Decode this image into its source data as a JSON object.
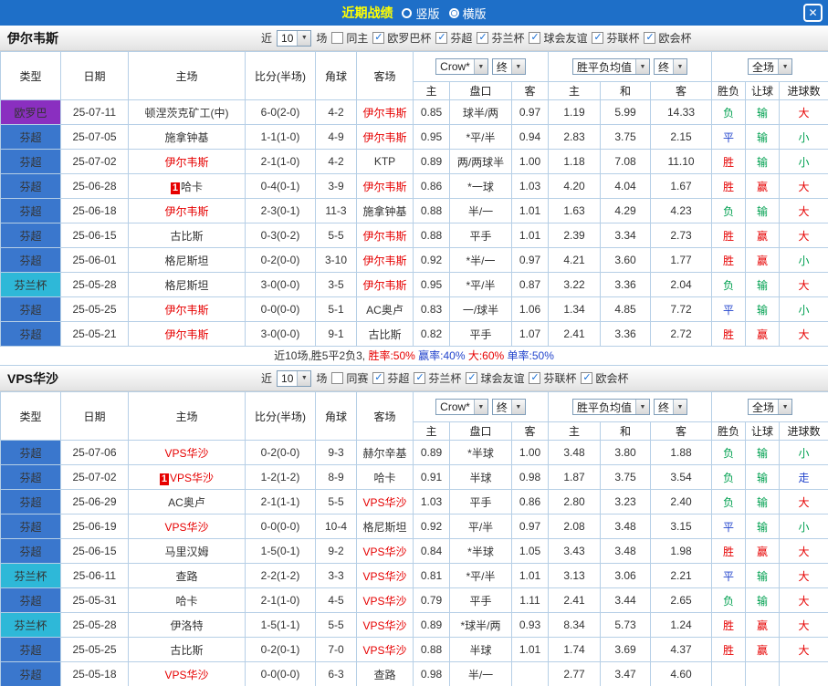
{
  "icons": {
    "dropdown": "▼",
    "check": "✓",
    "close": "✕"
  },
  "colors": {
    "titlebar_bg": "#1e6fc8",
    "title_text": "#ffff00",
    "focus_team": "#e60000",
    "opponent_team": "#333333",
    "score": "#ff0000",
    "grid": "#b6cfe6"
  },
  "titlebar": {
    "title": "近期战绩",
    "radios": [
      {
        "label": "竖版",
        "selected": false
      },
      {
        "label": "横版",
        "selected": true
      }
    ]
  },
  "header_labels": {
    "type": "类型",
    "date": "日期",
    "home": "主场",
    "score": "比分(半场)",
    "corner": "角球",
    "away": "客场",
    "odds_select": "Crow*",
    "final_select": "终",
    "avg_select": "胜平负均值",
    "scope_select": "全场",
    "sub": [
      "主",
      "盘口",
      "客",
      "主",
      "和",
      "客",
      "胜负",
      "让球",
      "进球数"
    ]
  },
  "type_colors": {
    "欧罗巴": "#8a2fc0",
    "芬超": "#3a77cd",
    "芬兰杯": "#2eb8d8"
  },
  "result_colors": {
    "胜": "#e60000",
    "赢": "#e60000",
    "大": "#e60000",
    "负": "#00a050",
    "输": "#00a050",
    "小": "#00a050",
    "平": "#2244cc",
    "走": "#2244cc"
  },
  "sections": [
    {
      "team": "伊尔韦斯",
      "filter": {
        "prefix": "近",
        "count": "10",
        "suffix": "场",
        "checkboxes": [
          {
            "label": "同主",
            "checked": false
          },
          {
            "label": "欧罗巴杯",
            "checked": true
          },
          {
            "label": "芬超",
            "checked": true
          },
          {
            "label": "芬兰杯",
            "checked": true
          },
          {
            "label": "球会友谊",
            "checked": true
          },
          {
            "label": "芬联杯",
            "checked": true
          },
          {
            "label": "欧会杯",
            "checked": true
          }
        ]
      },
      "rows": [
        {
          "type": "欧罗巴",
          "date": "25-07-11",
          "home": "顿涅茨克矿工(中)",
          "home_focus": false,
          "home_badge": "",
          "score": "6-0(2-0)",
          "corner": "4-2",
          "away": "伊尔韦斯",
          "away_focus": true,
          "odds": [
            "0.85",
            "球半/两",
            "0.97"
          ],
          "avg": [
            "1.19",
            "5.99",
            "14.33"
          ],
          "result": "负",
          "let": "输",
          "goals": "大"
        },
        {
          "type": "芬超",
          "date": "25-07-05",
          "home": "施拿钟基",
          "home_focus": false,
          "home_badge": "",
          "score": "1-1(1-0)",
          "corner": "4-9",
          "away": "伊尔韦斯",
          "away_focus": true,
          "odds": [
            "0.95",
            "*平/半",
            "0.94"
          ],
          "avg": [
            "2.83",
            "3.75",
            "2.15"
          ],
          "result": "平",
          "let": "输",
          "goals": "小"
        },
        {
          "type": "芬超",
          "date": "25-07-02",
          "home": "伊尔韦斯",
          "home_focus": true,
          "home_badge": "",
          "score": "2-1(1-0)",
          "corner": "4-2",
          "away": "KTP",
          "away_focus": false,
          "odds": [
            "0.89",
            "两/两球半",
            "1.00"
          ],
          "avg": [
            "1.18",
            "7.08",
            "11.10"
          ],
          "result": "胜",
          "let": "输",
          "goals": "小"
        },
        {
          "type": "芬超",
          "date": "25-06-28",
          "home": "哈卡",
          "home_focus": false,
          "home_badge": "1",
          "score": "0-4(0-1)",
          "corner": "3-9",
          "away": "伊尔韦斯",
          "away_focus": true,
          "odds": [
            "0.86",
            "*一球",
            "1.03"
          ],
          "avg": [
            "4.20",
            "4.04",
            "1.67"
          ],
          "result": "胜",
          "let": "赢",
          "goals": "大"
        },
        {
          "type": "芬超",
          "date": "25-06-18",
          "home": "伊尔韦斯",
          "home_focus": true,
          "home_badge": "",
          "score": "2-3(0-1)",
          "corner": "11-3",
          "away": "施拿钟基",
          "away_focus": false,
          "odds": [
            "0.88",
            "半/一",
            "1.01"
          ],
          "avg": [
            "1.63",
            "4.29",
            "4.23"
          ],
          "result": "负",
          "let": "输",
          "goals": "大"
        },
        {
          "type": "芬超",
          "date": "25-06-15",
          "home": "古比斯",
          "home_focus": false,
          "home_badge": "",
          "score": "0-3(0-2)",
          "corner": "5-5",
          "away": "伊尔韦斯",
          "away_focus": true,
          "odds": [
            "0.88",
            "平手",
            "1.01"
          ],
          "avg": [
            "2.39",
            "3.34",
            "2.73"
          ],
          "result": "胜",
          "let": "赢",
          "goals": "大"
        },
        {
          "type": "芬超",
          "date": "25-06-01",
          "home": "格尼斯坦",
          "home_focus": false,
          "home_badge": "",
          "score": "0-2(0-0)",
          "corner": "3-10",
          "away": "伊尔韦斯",
          "away_focus": true,
          "odds": [
            "0.92",
            "*半/一",
            "0.97"
          ],
          "avg": [
            "4.21",
            "3.60",
            "1.77"
          ],
          "result": "胜",
          "let": "赢",
          "goals": "小"
        },
        {
          "type": "芬兰杯",
          "date": "25-05-28",
          "home": "格尼斯坦",
          "home_focus": false,
          "home_badge": "",
          "score": "3-0(0-0)",
          "corner": "3-5",
          "away": "伊尔韦斯",
          "away_focus": true,
          "odds": [
            "0.95",
            "*平/半",
            "0.87"
          ],
          "avg": [
            "3.22",
            "3.36",
            "2.04"
          ],
          "result": "负",
          "let": "输",
          "goals": "大"
        },
        {
          "type": "芬超",
          "date": "25-05-25",
          "home": "伊尔韦斯",
          "home_focus": true,
          "home_badge": "",
          "score": "0-0(0-0)",
          "corner": "5-1",
          "away": "AC奥卢",
          "away_focus": false,
          "odds": [
            "0.83",
            "一/球半",
            "1.06"
          ],
          "avg": [
            "1.34",
            "4.85",
            "7.72"
          ],
          "result": "平",
          "let": "输",
          "goals": "小"
        },
        {
          "type": "芬超",
          "date": "25-05-21",
          "home": "伊尔韦斯",
          "home_focus": true,
          "home_badge": "",
          "score": "3-0(0-0)",
          "corner": "9-1",
          "away": "古比斯",
          "away_focus": false,
          "odds": [
            "0.82",
            "平手",
            "1.07"
          ],
          "avg": [
            "2.41",
            "3.36",
            "2.72"
          ],
          "result": "胜",
          "let": "赢",
          "goals": "大"
        }
      ],
      "summary": [
        {
          "text": "近10场,胜5平2负3, ",
          "color": "#333333"
        },
        {
          "text": "胜率:50%",
          "color": "#e60000"
        },
        {
          "text": " 赢率:40%",
          "color": "#2244cc"
        },
        {
          "text": " 大:60%",
          "color": "#e60000"
        },
        {
          "text": " 单率:50%",
          "color": "#2244cc"
        }
      ]
    },
    {
      "team": "VPS华沙",
      "filter": {
        "prefix": "近",
        "count": "10",
        "suffix": "场",
        "checkboxes": [
          {
            "label": "同赛",
            "checked": false
          },
          {
            "label": "芬超",
            "checked": true
          },
          {
            "label": "芬兰杯",
            "checked": true
          },
          {
            "label": "球会友谊",
            "checked": true
          },
          {
            "label": "芬联杯",
            "checked": true
          },
          {
            "label": "欧会杯",
            "checked": true
          }
        ]
      },
      "rows": [
        {
          "type": "芬超",
          "date": "25-07-06",
          "home": "VPS华沙",
          "home_focus": true,
          "home_badge": "",
          "score": "0-2(0-0)",
          "corner": "9-3",
          "away": "赫尔辛基",
          "away_focus": false,
          "odds": [
            "0.89",
            "*半球",
            "1.00"
          ],
          "avg": [
            "3.48",
            "3.80",
            "1.88"
          ],
          "result": "负",
          "let": "输",
          "goals": "小"
        },
        {
          "type": "芬超",
          "date": "25-07-02",
          "home": "VPS华沙",
          "home_focus": true,
          "home_badge": "1",
          "score": "1-2(1-2)",
          "corner": "8-9",
          "away": "哈卡",
          "away_focus": false,
          "odds": [
            "0.91",
            "半球",
            "0.98"
          ],
          "avg": [
            "1.87",
            "3.75",
            "3.54"
          ],
          "result": "负",
          "let": "输",
          "goals": "走"
        },
        {
          "type": "芬超",
          "date": "25-06-29",
          "home": "AC奥卢",
          "home_focus": false,
          "home_badge": "",
          "score": "2-1(1-1)",
          "corner": "5-5",
          "away": "VPS华沙",
          "away_focus": true,
          "odds": [
            "1.03",
            "平手",
            "0.86"
          ],
          "avg": [
            "2.80",
            "3.23",
            "2.40"
          ],
          "result": "负",
          "let": "输",
          "goals": "大"
        },
        {
          "type": "芬超",
          "date": "25-06-19",
          "home": "VPS华沙",
          "home_focus": true,
          "home_badge": "",
          "score": "0-0(0-0)",
          "corner": "10-4",
          "away": "格尼斯坦",
          "away_focus": false,
          "odds": [
            "0.92",
            "平/半",
            "0.97"
          ],
          "avg": [
            "2.08",
            "3.48",
            "3.15"
          ],
          "result": "平",
          "let": "输",
          "goals": "小"
        },
        {
          "type": "芬超",
          "date": "25-06-15",
          "home": "马里汉姆",
          "home_focus": false,
          "home_badge": "",
          "score": "1-5(0-1)",
          "corner": "9-2",
          "away": "VPS华沙",
          "away_focus": true,
          "odds": [
            "0.84",
            "*半球",
            "1.05"
          ],
          "avg": [
            "3.43",
            "3.48",
            "1.98"
          ],
          "result": "胜",
          "let": "赢",
          "goals": "大"
        },
        {
          "type": "芬兰杯",
          "date": "25-06-11",
          "home": "查路",
          "home_focus": false,
          "home_badge": "",
          "score": "2-2(1-2)",
          "corner": "3-3",
          "away": "VPS华沙",
          "away_focus": true,
          "odds": [
            "0.81",
            "*平/半",
            "1.01"
          ],
          "avg": [
            "3.13",
            "3.06",
            "2.21"
          ],
          "result": "平",
          "let": "输",
          "goals": "大"
        },
        {
          "type": "芬超",
          "date": "25-05-31",
          "home": "哈卡",
          "home_focus": false,
          "home_badge": "",
          "score": "2-1(1-0)",
          "corner": "4-5",
          "away": "VPS华沙",
          "away_focus": true,
          "odds": [
            "0.79",
            "平手",
            "1.11"
          ],
          "avg": [
            "2.41",
            "3.44",
            "2.65"
          ],
          "result": "负",
          "let": "输",
          "goals": "大"
        },
        {
          "type": "芬兰杯",
          "date": "25-05-28",
          "home": "伊洛特",
          "home_focus": false,
          "home_badge": "",
          "score": "1-5(1-1)",
          "corner": "5-5",
          "away": "VPS华沙",
          "away_focus": true,
          "odds": [
            "0.89",
            "*球半/两",
            "0.93"
          ],
          "avg": [
            "8.34",
            "5.73",
            "1.24"
          ],
          "result": "胜",
          "let": "赢",
          "goals": "大"
        },
        {
          "type": "芬超",
          "date": "25-05-25",
          "home": "古比斯",
          "home_focus": false,
          "home_badge": "",
          "score": "0-2(0-1)",
          "corner": "7-0",
          "away": "VPS华沙",
          "away_focus": true,
          "odds": [
            "0.88",
            "半球",
            "1.01"
          ],
          "avg": [
            "1.74",
            "3.69",
            "4.37"
          ],
          "result": "胜",
          "let": "赢",
          "goals": "大"
        },
        {
          "type": "芬超",
          "date": "25-05-18",
          "home": "VPS华沙",
          "home_focus": true,
          "home_badge": "",
          "score": "0-0(0-0)",
          "corner": "6-3",
          "away": "查路",
          "away_focus": false,
          "odds": [
            "0.98",
            "半/一",
            ""
          ],
          "avg": [
            "2.77",
            "3.47",
            "4.60"
          ],
          "result": "",
          "let": "",
          "goals": ""
        }
      ],
      "summary": null
    }
  ]
}
